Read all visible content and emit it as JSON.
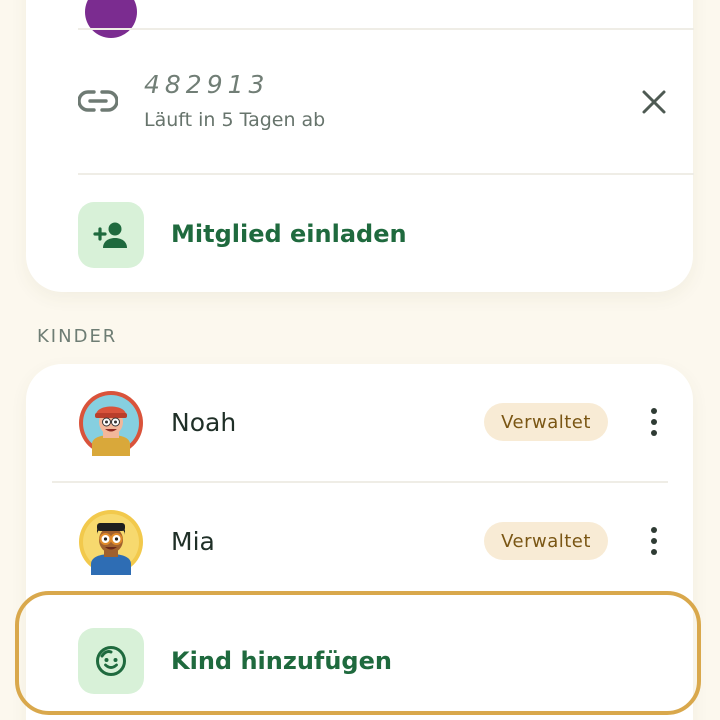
{
  "invite": {
    "code": "482913",
    "expiry": "Läuft in 5 Tagen ab",
    "icon": "link-icon",
    "close_icon": "close-icon"
  },
  "invite_member": {
    "label": "Mitglied einladen",
    "icon": "person-add-icon"
  },
  "children_section": {
    "title": "KINDER",
    "children": [
      {
        "name": "Noah",
        "badge": "Verwaltet",
        "avatar": "boy-with-red-cap-avatar"
      },
      {
        "name": "Mia",
        "badge": "Verwaltet",
        "avatar": "child-with-glasses-avatar"
      }
    ],
    "add_child": {
      "label": "Kind hinzufügen",
      "icon": "smiley-face-icon"
    }
  },
  "colors": {
    "background": "#FCF8EE",
    "card": "#FFFFFF",
    "accent_green": "#1F6A3E",
    "icon_box_green": "#D8F1D8",
    "badge_bg": "#F8EBD5",
    "badge_text": "#7A5614",
    "highlight_border": "#D9A84C"
  }
}
